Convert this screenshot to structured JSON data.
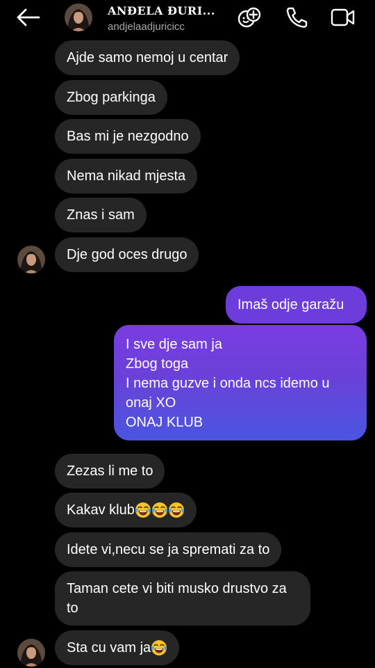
{
  "header": {
    "name": "ANĐELA ĐURI...",
    "handle": "andjelaadjuricicc"
  },
  "icons": {
    "back": "arrow-left-icon",
    "effects": "face-plus-icon",
    "call": "phone-icon",
    "video": "video-camera-icon",
    "laugh": "face-with-tears-of-joy-icon"
  },
  "colors": {
    "received_bubble": "#262626",
    "sent_gradient_top": "#7a3ce0",
    "sent_gradient_bottom": "#4a56e0"
  },
  "messages": {
    "m1": "Ajde samo nemoj u centar",
    "m2": "Zbog parkinga",
    "m3": "Bas mi je nezgodno",
    "m4": "Nema nikad mjesta",
    "m5": "Znas i sam",
    "m6": "Dje god oces drugo",
    "s1": "Imaš odje garažu",
    "s2": [
      "I sve dje sam ja",
      "Zbog toga",
      "I nema guzve i onda ncs idemo u",
      "onaj XO",
      "ONAJ KLUB"
    ],
    "m7": "Zezas li me to",
    "m8": "Kakav klub",
    "m9": "Idete vi,necu se ja spremati za to",
    "m10": "Taman cete vi biti musko drustvo za to",
    "m11": "Sta cu vam ja "
  }
}
